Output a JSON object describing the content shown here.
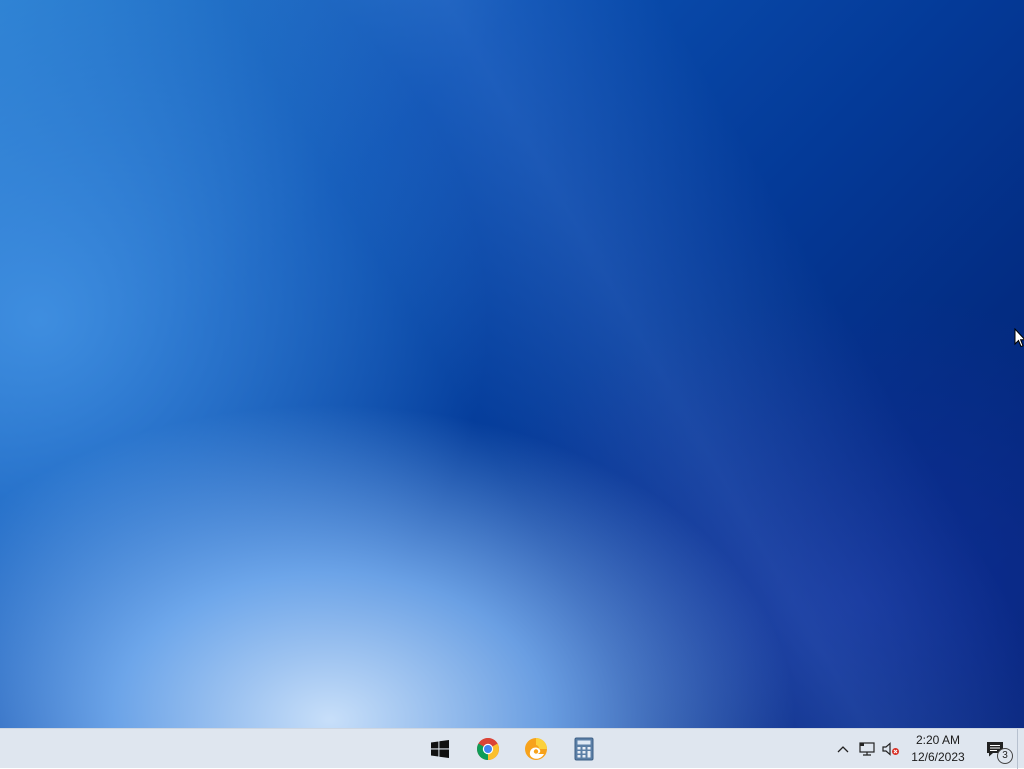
{
  "desktop": {
    "wallpaper_colors": [
      "#2a7fd0",
      "#0a4fb0",
      "#032c82",
      "#021f6e",
      "#d2e8ff"
    ]
  },
  "taskbar": {
    "background": "#dfe6ef",
    "pinned": [
      {
        "name": "start",
        "icon": "windows-logo-icon"
      },
      {
        "name": "chrome",
        "icon": "chrome-icon"
      },
      {
        "name": "edge-canary",
        "icon": "edge-canary-icon"
      },
      {
        "name": "calculator",
        "icon": "calculator-icon"
      }
    ]
  },
  "tray": {
    "icons": [
      "chevron-up-icon",
      "network-icon",
      "volume-muted-icon"
    ],
    "time": "2:20 AM",
    "date": "12/6/2023",
    "notification_count": "3"
  }
}
